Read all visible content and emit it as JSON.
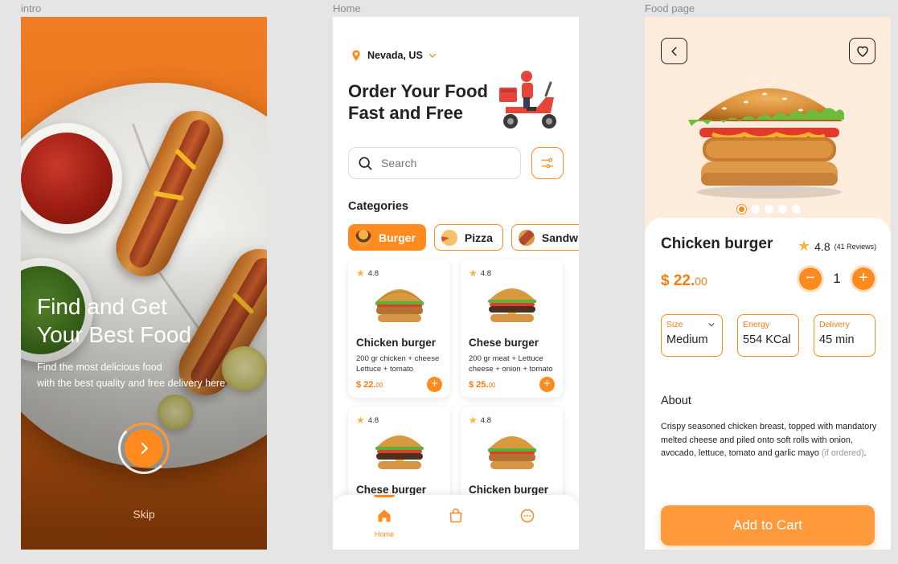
{
  "frames": {
    "intro": {
      "label": "intro"
    },
    "home": {
      "label": "Home"
    },
    "food": {
      "label": "Food page"
    }
  },
  "intro": {
    "title_line1": "Find and Get",
    "title_line2": "Your Best Food",
    "subtitle_line1": "Find the most delicious food",
    "subtitle_line2": "with the best quality and free delivery here",
    "next_icon": "chevron-right-icon",
    "skip_label": "Skip"
  },
  "home": {
    "location": "Nevada, US",
    "title_line1": "Order Your Food",
    "title_line2": "Fast and Free",
    "search_placeholder": "Search",
    "categories_title": "Categories",
    "categories": [
      {
        "label": "Burger",
        "icon": "burger-icon",
        "active": true
      },
      {
        "label": "Pizza",
        "icon": "pizza-icon",
        "active": false
      },
      {
        "label": "Sandwich",
        "icon": "hotdog-icon",
        "active": false
      }
    ],
    "cards": [
      {
        "rating": "4.8",
        "name": "Chicken burger",
        "desc": "200 gr chicken + cheese Lettuce + tomato",
        "price_main": "$ 22.",
        "price_cents": "00"
      },
      {
        "rating": "4.8",
        "name": "Chese burger",
        "desc": "200 gr meat + Lettuce cheese + onion + tomato",
        "price_main": "$ 25.",
        "price_cents": "00"
      },
      {
        "rating": "4.8",
        "name": "Chese burger",
        "desc": "",
        "price_main": "",
        "price_cents": ""
      },
      {
        "rating": "4.8",
        "name": "Chicken burger",
        "desc": "",
        "price_main": "",
        "price_cents": ""
      }
    ],
    "nav": [
      {
        "label": "Home",
        "icon": "home-icon",
        "active": true
      },
      {
        "label": "",
        "icon": "bag-icon",
        "active": false
      },
      {
        "label": "",
        "icon": "chat-icon",
        "active": false
      }
    ]
  },
  "food": {
    "name": "Chicken burger",
    "rating": "4.8",
    "reviews": "(41 Reviews)",
    "price_main": "$ 22.",
    "price_cents": "00",
    "quantity": "1",
    "image_index": 1,
    "image_count": 5,
    "specs": [
      {
        "label": "Size",
        "value": "Medium"
      },
      {
        "label": "Energy",
        "value": "554 KCal"
      },
      {
        "label": "Delivery",
        "value": "45 min"
      }
    ],
    "about_title": "About",
    "about_text": "Crispy seasoned chicken breast, topped with mandatory melted cheese and piled onto soft rolls with onion, avocado, lettuce, tomato and garlic mayo",
    "about_note": "(if ordered)",
    "about_end": ".",
    "cta": "Add to Cart"
  },
  "colors": {
    "accent": "#ff8a1e",
    "intro_bg": "#e46c17",
    "food_bg": "#fdebdc"
  }
}
